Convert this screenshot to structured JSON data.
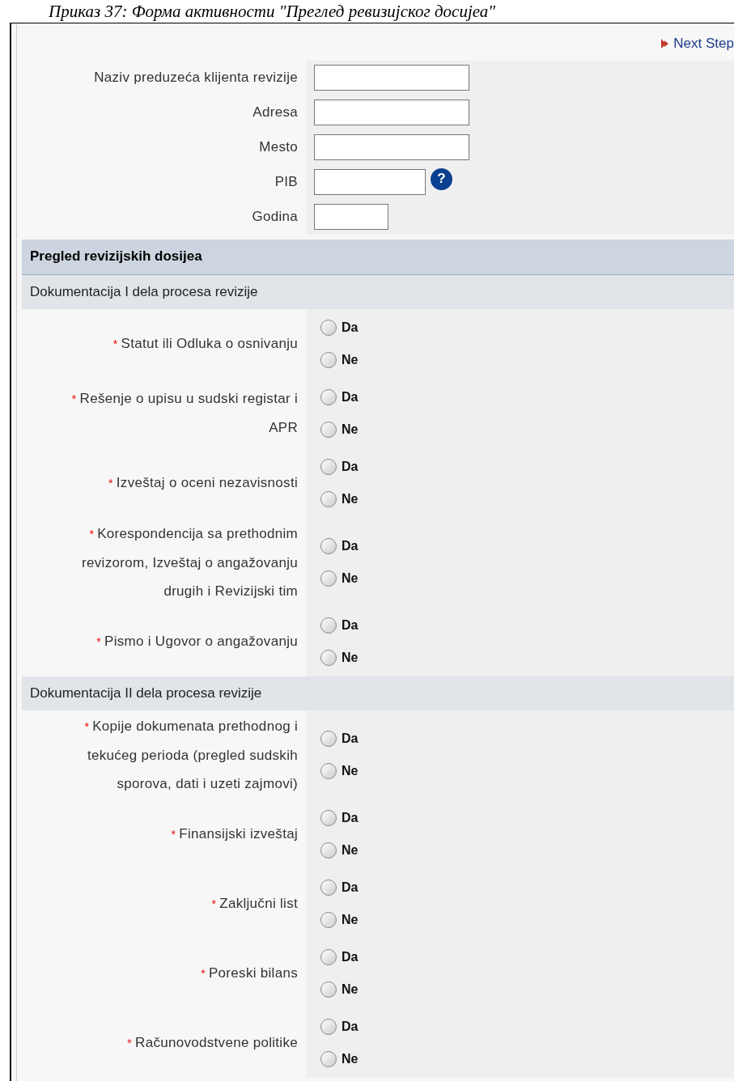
{
  "caption": "Приказ 37: Форма активности \"Преглед ревизијског досијеа\"",
  "next_step": {
    "label": "Next Step"
  },
  "fields": [
    {
      "label": "Naziv preduzeća klijenta revizije",
      "kind": "wide"
    },
    {
      "label": "Adresa",
      "kind": "wide"
    },
    {
      "label": "Mesto",
      "kind": "wide"
    },
    {
      "label": "PIB",
      "kind": "help",
      "help": "?"
    },
    {
      "label": "Godina",
      "kind": "short"
    }
  ],
  "section": {
    "title": "Pregled revizijskih dosijea"
  },
  "groups": [
    {
      "title": "Dokumentacija I dela procesa revizije",
      "questions": [
        {
          "label": "Statut ili Odluka o osnivanju",
          "marker": "*",
          "options": [
            {
              "label": "Da",
              "selected": false
            },
            {
              "label": "Ne",
              "selected": false
            }
          ]
        },
        {
          "label": "Rešenje o upisu u sudski registar i APR",
          "marker": "*",
          "options": [
            {
              "label": "Da",
              "selected": false
            },
            {
              "label": "Ne",
              "selected": false
            }
          ]
        },
        {
          "label": "Izveštaj o oceni nezavisnosti",
          "marker": "*",
          "options": [
            {
              "label": "Da",
              "selected": false
            },
            {
              "label": "Ne",
              "selected": false
            }
          ]
        },
        {
          "label": "Korespondencija sa prethodnim revizorom, Izveštaj o angažovanju drugih i Revizijski tim",
          "marker": "*",
          "options": [
            {
              "label": "Da",
              "selected": false
            },
            {
              "label": "Ne",
              "selected": false
            }
          ]
        },
        {
          "label": "Pismo i Ugovor o angažovanju",
          "marker": "*",
          "options": [
            {
              "label": "Da",
              "selected": false
            },
            {
              "label": "Ne",
              "selected": false
            }
          ]
        }
      ]
    },
    {
      "title": "Dokumentacija II dela procesa revizije",
      "questions": [
        {
          "label": "Kopije dokumenata prethodnog i tekućeg perioda (pregled sudskih sporova, dati i uzeti zajmovi)",
          "marker": "*",
          "options": [
            {
              "label": "Da",
              "selected": false
            },
            {
              "label": "Ne",
              "selected": false
            }
          ]
        },
        {
          "label": "Finansijski izveštaj",
          "marker": "*",
          "options": [
            {
              "label": "Da",
              "selected": false
            },
            {
              "label": "Ne",
              "selected": false
            }
          ]
        },
        {
          "label": "Zaključni list",
          "marker": "*",
          "options": [
            {
              "label": "Da",
              "selected": false
            },
            {
              "label": "Ne",
              "selected": false
            }
          ]
        },
        {
          "label": "Poreski bilans",
          "marker": "*",
          "options": [
            {
              "label": "Da",
              "selected": false
            },
            {
              "label": "Ne",
              "selected": false
            }
          ]
        },
        {
          "label": "Računovodstvene politike",
          "marker": "*",
          "options": [
            {
              "label": "Da",
              "selected": false
            },
            {
              "label": "Ne",
              "selected": false
            }
          ]
        }
      ]
    }
  ]
}
